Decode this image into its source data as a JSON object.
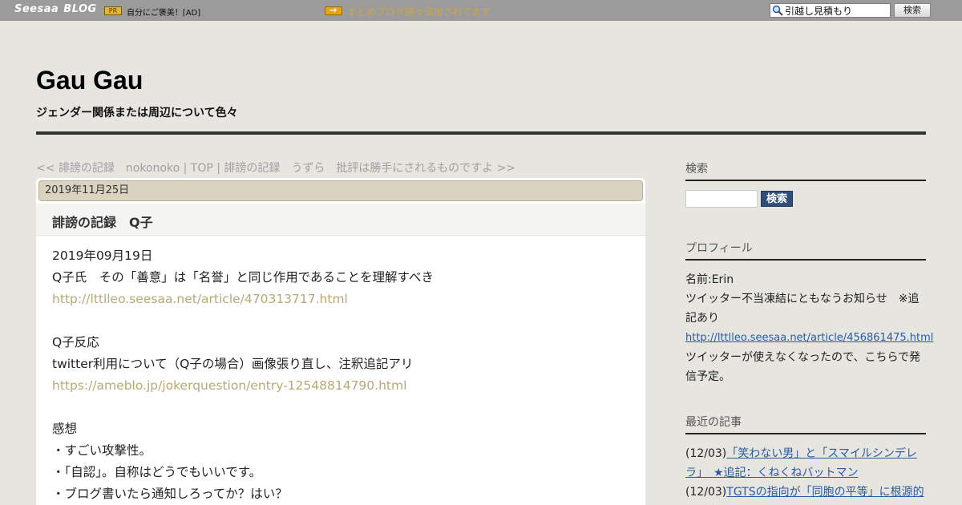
{
  "topbar": {
    "logo_seesaa": "Seesaa",
    "logo_blog": "BLOG",
    "pr_badge": "PR",
    "ad_text": "自分にご褒美！[AD]",
    "announcement": "まとめブログ続々追加されてます",
    "search_value": "引越し見積もり",
    "search_button": "検索"
  },
  "header": {
    "title": "Gau Gau",
    "description": "ジェンダー関係または周辺について色々"
  },
  "nav": {
    "prev": "<< 誹謗の記録　nokonoko",
    "separator1": " | ",
    "top": "TOP",
    "separator2": " | ",
    "next": "誹謗の記録　うずら　批評は勝手にされるものですよ >>"
  },
  "article": {
    "date": "2019年11月25日",
    "title": "誹謗の記録　Q子",
    "lines": [
      {
        "text": "2019年09月19日",
        "link": false
      },
      {
        "text": "Q子氏　その「善意」は「名誉」と同じ作用であることを理解すべき",
        "link": false
      },
      {
        "text": "http://lttlleo.seesaa.net/article/470313717.html",
        "link": true
      },
      {
        "text": "",
        "link": false
      },
      {
        "text": "Q子反応",
        "link": false
      },
      {
        "text": "twitter利用について（Q子の場合）画像張り直し、注釈追記アリ",
        "link": false
      },
      {
        "text": "https://ameblo.jp/jokerquestion/entry-12548814790.html",
        "link": true
      },
      {
        "text": "",
        "link": false
      },
      {
        "text": "感想",
        "link": false
      },
      {
        "text": "・すごい攻撃性。",
        "link": false
      },
      {
        "text": "・「自認」。自称はどうでもいいです。",
        "link": false
      },
      {
        "text": "・ブログ書いたら通知しろってか？はい？",
        "link": false
      }
    ]
  },
  "sidebar": {
    "search_heading": "検索",
    "search_button": "検索",
    "profile_heading": "プロフィール",
    "profile_name": "名前:Erin",
    "profile_text1": "ツイッター不当凍結にともなうお知らせ　※追記あり",
    "profile_link": "http://lttlleo.seesaa.net/article/456861475.html",
    "profile_text2": "ツイッターが使えなくなったので、こちらで発信予定。",
    "recent_heading": "最近の記事",
    "recent_items": [
      {
        "date": "(12/03)",
        "title": "「笑わない男」と「スマイルシンデレラ」　★追記：くねくねバットマン"
      },
      {
        "date": "(12/03)",
        "title": "TGTSの指向が「同胞の平等」に根源的に対立する件"
      }
    ]
  }
}
